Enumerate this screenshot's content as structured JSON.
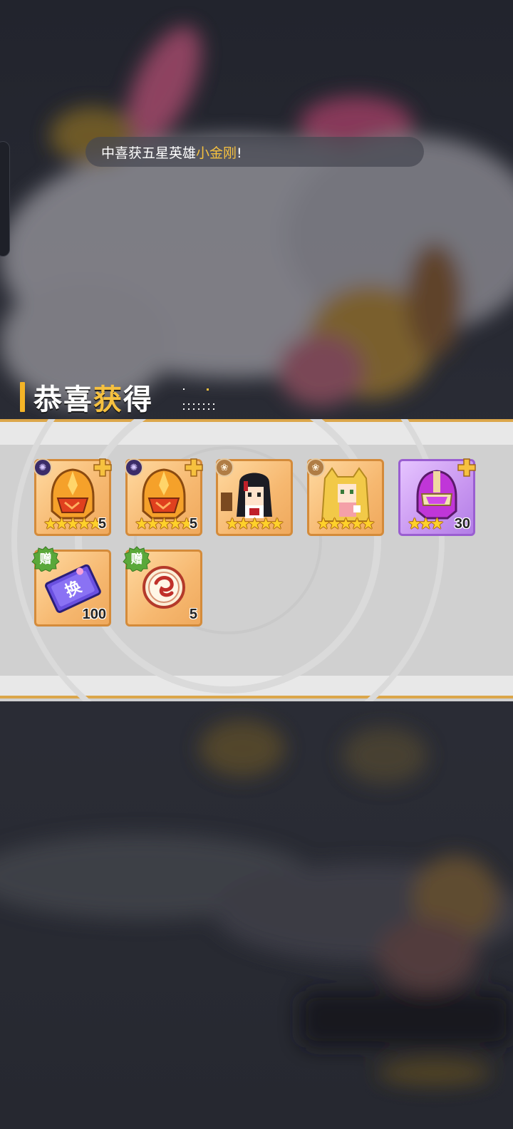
{
  "ticker": {
    "prefix": "中喜获五星英雄",
    "highlight": "小金刚",
    "suffix": "!"
  },
  "title": {
    "part1": "恭喜",
    "part2": "获",
    "part3": "得"
  },
  "rewards": [
    {
      "icon": "orange-helmet-icon",
      "badge": "purple-element-icon",
      "stars": 5,
      "count": "5",
      "frame": "orange"
    },
    {
      "icon": "orange-helmet-icon",
      "badge": "purple-element-icon",
      "stars": 5,
      "count": "5",
      "frame": "orange"
    },
    {
      "icon": "black-hair-hero-icon",
      "badge": "lotus-icon",
      "stars": 5,
      "count": "",
      "frame": "orange"
    },
    {
      "icon": "blonde-hero-icon",
      "badge": "lotus-icon",
      "stars": 5,
      "count": "",
      "frame": "orange"
    },
    {
      "icon": "purple-helmet-icon",
      "badge": "",
      "stars": 3,
      "count": "30",
      "frame": "purple"
    },
    {
      "icon": "exchange-ticket-icon",
      "gift": "赠",
      "stars": 0,
      "count": "100",
      "frame": "orange"
    },
    {
      "icon": "dragon-coin-icon",
      "gift": "赠",
      "stars": 0,
      "count": "5",
      "frame": "orange"
    }
  ],
  "ticket_glyph": "换",
  "colors": {
    "accent": "#f6c13f",
    "frame": "#d48b3a",
    "purple_frame": "#9a5ed1",
    "band": "#dba64a"
  }
}
